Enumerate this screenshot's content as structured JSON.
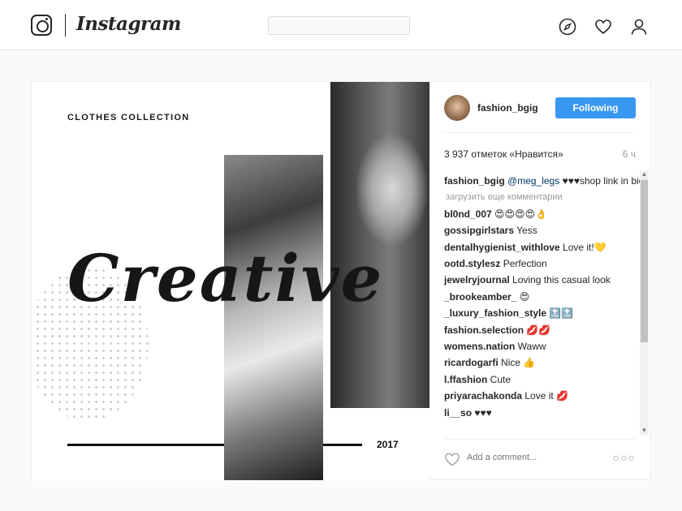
{
  "header": {
    "logo": "Instagram",
    "search_placeholder": "",
    "icons": [
      "explore-compass-icon",
      "activity-heart-icon",
      "profile-icon"
    ]
  },
  "post": {
    "image": {
      "collection_title": "CLOTHES COLLECTION",
      "headline": "Creative",
      "year": "2017"
    },
    "author": "fashion_bgig",
    "follow_label": "Following",
    "likes": "3 937 отметок «Нравится»",
    "time": "6 ч",
    "caption": {
      "user": "fashion_bgig",
      "mention": "@meg_legs",
      "text": " ♥♥♥shop link in bio"
    },
    "load_more": "загрузить еще комментарии",
    "comments": [
      {
        "user": "bl0nd_007",
        "text": " 😍😍😍😍👌"
      },
      {
        "user": "gossipgirlstars",
        "text": " Yess"
      },
      {
        "user": "dentalhygienist_withlove",
        "text": " Love it!💛"
      },
      {
        "user": "ootd.stylesz",
        "text": " Perfection"
      },
      {
        "user": "jewelryjournal",
        "text": " Loving this casual look"
      },
      {
        "user": "_brookeamber_",
        "text": " 😍"
      },
      {
        "user": "_luxury_fashion_style",
        "text": " 🔝🔝"
      },
      {
        "user": "fashion.selection",
        "text": " 💋💋"
      },
      {
        "user": "womens.nation",
        "text": " Waww"
      },
      {
        "user": "ricardogarfi",
        "text": " Nice 👍"
      },
      {
        "user": "l.ffashion",
        "text": " Cute"
      },
      {
        "user": "priyarachakonda",
        "text": " Love it 💋"
      },
      {
        "user": "li__so",
        "text": " ♥♥♥"
      }
    ],
    "add_comment_placeholder": "Add a comment...",
    "more_options": "○○○"
  },
  "colors": {
    "accent": "#3897f0",
    "text": "#262626",
    "muted": "#999999",
    "border": "#efefef"
  }
}
